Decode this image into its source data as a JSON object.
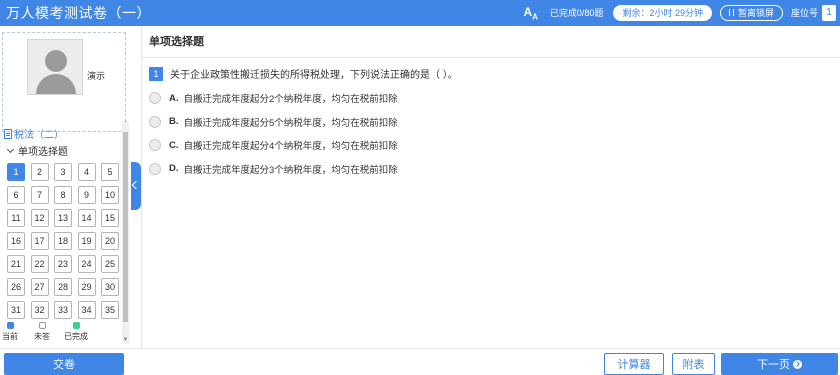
{
  "header": {
    "title": "万人模考测试卷（一）",
    "font_icon": "A",
    "font_icon_sub": "A",
    "progress_text": "已完成0/80题",
    "timer_text": "剩余：2小时 29分钟",
    "pause_label": "暂离锁屏",
    "seat_label": "座位号",
    "seat_number": "1"
  },
  "sidebar": {
    "candidate_name": "演示",
    "section_title": "税法（二）",
    "group_title": "单项选择题",
    "question_numbers": [
      "1",
      "2",
      "3",
      "4",
      "5",
      "6",
      "7",
      "8",
      "9",
      "10",
      "11",
      "12",
      "13",
      "14",
      "15",
      "16",
      "17",
      "18",
      "19",
      "20",
      "21",
      "22",
      "23",
      "24",
      "25",
      "26",
      "27",
      "28",
      "29",
      "30",
      "31",
      "32",
      "33",
      "34",
      "35"
    ],
    "current_question": "1",
    "legend": [
      {
        "label": "当前",
        "color": "#3f86e6"
      },
      {
        "label": "未答",
        "color": "#ffffff"
      },
      {
        "label": "已完成",
        "color": "#3ecf8e"
      }
    ]
  },
  "main": {
    "section_heading": "单项选择题",
    "question_index": "1",
    "question_text": "关于企业政策性搬迁损失的所得税处理，下列说法正确的是（    ）。",
    "options": [
      {
        "letter": "A.",
        "text": "自搬迁完成年度起分2个纳税年度，均匀在税前扣除"
      },
      {
        "letter": "B.",
        "text": "自搬迁完成年度起分5个纳税年度，均匀在税前扣除"
      },
      {
        "letter": "C.",
        "text": "自搬迁完成年度起分4个纳税年度，均匀在税前扣除"
      },
      {
        "letter": "D.",
        "text": "自搬迁完成年度起分3个纳税年度，均匀在税前扣除"
      }
    ]
  },
  "footer": {
    "submit_label": "交卷",
    "calculator_label": "计算器",
    "appendix_label": "附表",
    "next_label": "下一页"
  },
  "colors": {
    "accent": "#3f86e6",
    "done": "#3ecf8e"
  }
}
